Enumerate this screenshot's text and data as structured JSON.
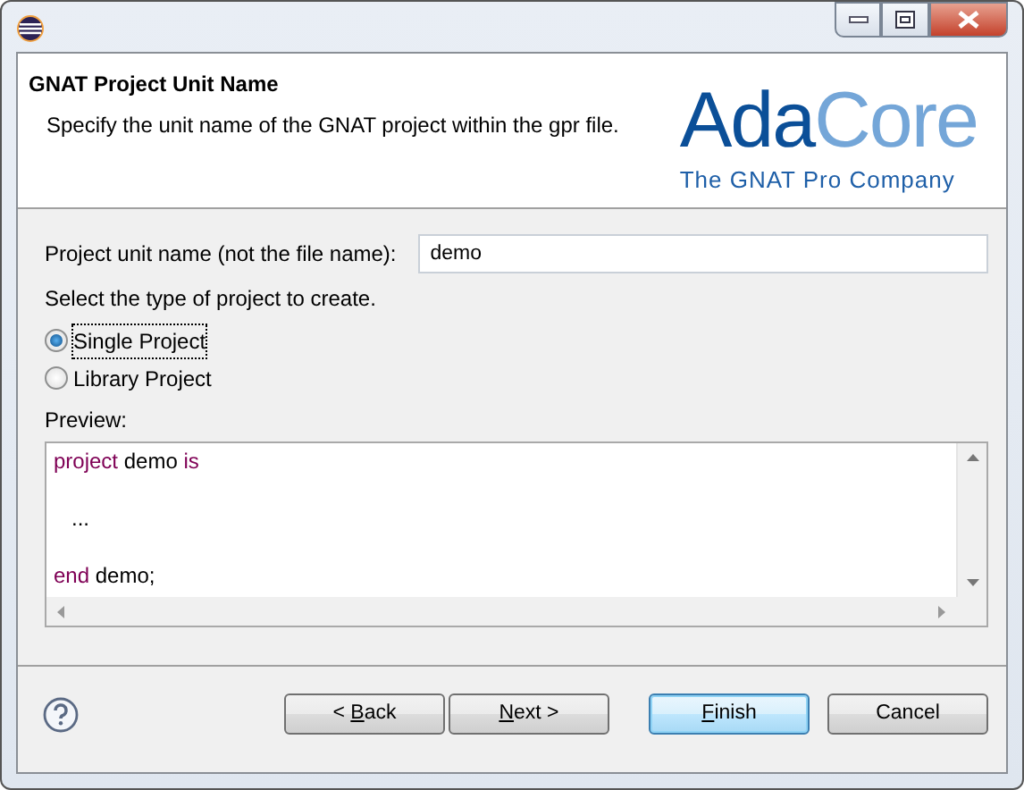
{
  "window": {
    "title_controls": [
      {
        "kind": "minimize"
      },
      {
        "kind": "maximize"
      },
      {
        "kind": "close"
      }
    ]
  },
  "header": {
    "title": "GNAT Project Unit Name",
    "description": "Specify the unit name of the GNAT project within the gpr file.",
    "logo": {
      "primary": "Ada",
      "secondary": "Core",
      "tagline": "The GNAT Pro Company"
    }
  },
  "form": {
    "name_label": "Project unit name (not the file name):",
    "name_value": "demo",
    "type_label": "Select the type of project to create.",
    "project_types": [
      {
        "label": "Single Project",
        "selected": true
      },
      {
        "label": "Library Project",
        "selected": false
      }
    ],
    "preview_label": "Preview:",
    "preview_lines": [
      {
        "tokens": [
          {
            "kind": "keyword",
            "text": "project"
          },
          {
            "kind": "plain",
            "text": " demo "
          },
          {
            "kind": "keyword",
            "text": "is"
          }
        ]
      },
      {
        "kind": "blank"
      },
      {
        "tokens": [
          {
            "kind": "plain",
            "text": "   ..."
          }
        ]
      },
      {
        "kind": "blank"
      },
      {
        "tokens": [
          {
            "kind": "keyword",
            "text": "end"
          },
          {
            "kind": "plain",
            "text": " demo;"
          }
        ]
      }
    ]
  },
  "buttons": [
    {
      "before": "< ",
      "key": "B",
      "after": "ack",
      "default": false
    },
    {
      "key": "N",
      "after": "ext >",
      "default": false
    },
    {
      "key": "F",
      "after": "inish",
      "default": true
    },
    {
      "before": "Cancel",
      "default": false
    }
  ]
}
